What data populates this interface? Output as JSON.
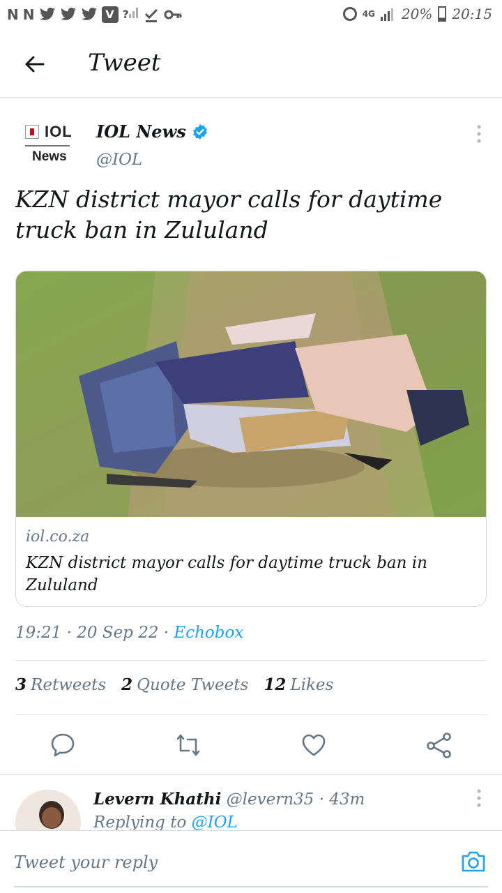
{
  "status_bar": {
    "left_icons": [
      "N",
      "N",
      "bird",
      "bird",
      "bird",
      "V"
    ],
    "signal_text": "?",
    "network": "4G",
    "battery": "20%",
    "time": "20:15"
  },
  "header": {
    "title": "Tweet"
  },
  "tweet": {
    "avatar_logo": {
      "brand": "IOL",
      "sub": "News"
    },
    "author_name": "IOL News",
    "author_handle": "@IOL",
    "text": "KZN district mayor calls for daytime truck ban in Zululand",
    "card": {
      "domain": "iol.co.za",
      "title": "KZN district mayor calls for daytime truck ban in Zululand"
    },
    "time": "19:21",
    "date": "20 Sep 22",
    "separator": "·",
    "source": "Echobox",
    "stats": {
      "retweets_count": "3",
      "retweets_label": "Retweets",
      "quotes_count": "2",
      "quotes_label": "Quote Tweets",
      "likes_count": "12",
      "likes_label": "Likes"
    }
  },
  "reply": {
    "name": "Levern Khathi",
    "handle": "@levern35",
    "separator": "·",
    "age": "43m",
    "replying_to_label": "Replying to",
    "replying_to_handle": "@IOL"
  },
  "composer": {
    "placeholder": "Tweet your reply"
  },
  "colors": {
    "accent": "#1da1f2",
    "secondary_text": "#657786",
    "primary_text": "#14171a",
    "divider": "#e1e6ea"
  }
}
